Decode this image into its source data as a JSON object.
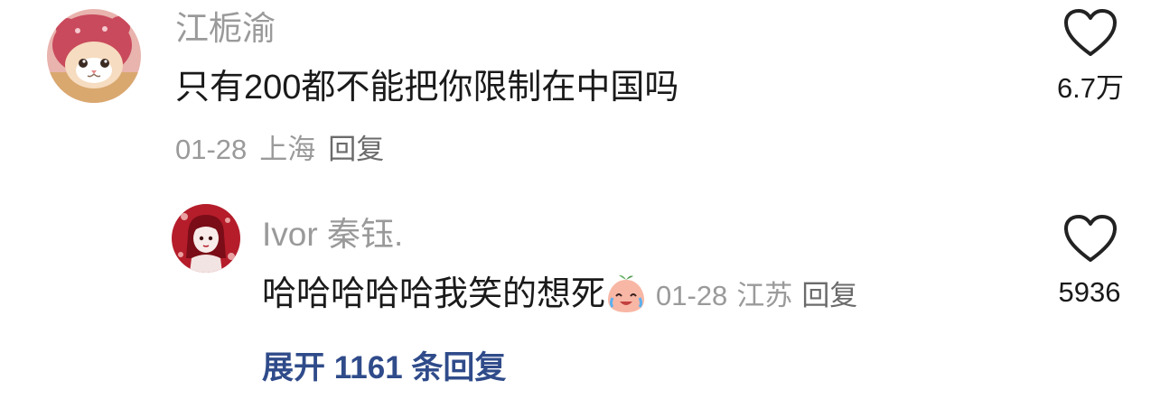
{
  "comment": {
    "username": "江栀渝",
    "text": "只有200都不能把你限制在中国吗",
    "date": "01-28",
    "location": "上海",
    "reply_label": "回复",
    "like_count": "6.7万",
    "like_icon": "heart-outline-icon",
    "avatar_icon": "cat-avatar"
  },
  "reply": {
    "username": "Ivor 秦钰.",
    "text": "哈哈哈哈哈我笑的想死",
    "emoji": "laughing-crying-peach-emoji",
    "date": "01-28",
    "location": "江苏",
    "reply_label": "回复",
    "like_count": "5936",
    "like_icon": "heart-outline-icon",
    "avatar_icon": "anime-girl-avatar"
  },
  "expand_replies": "展开 1161 条回复",
  "colors": {
    "secondary_text": "#9a9a9a",
    "primary_text": "#1a1a1a",
    "link": "#2f4b8a",
    "avatar_bg_main": "#e8a6a2",
    "avatar_bg_reply": "#b71c2a"
  }
}
